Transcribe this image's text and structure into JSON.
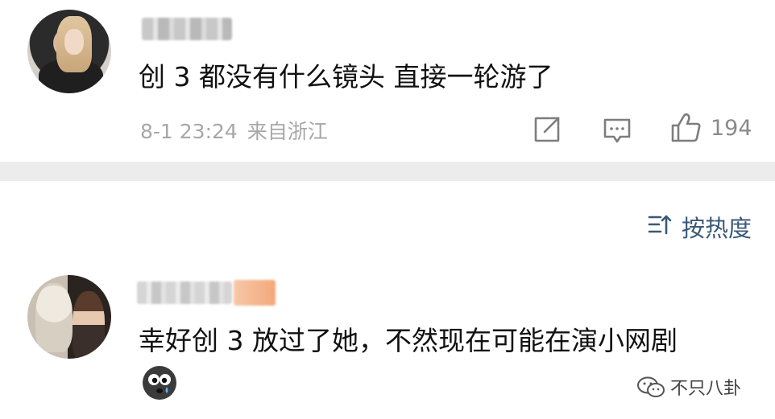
{
  "comments": [
    {
      "text": "创 3 都没有什么镜头 直接一轮游了",
      "meta": {
        "date": "8-1 23:24",
        "location": "来自浙江"
      },
      "like_count": "194"
    },
    {
      "text": "幸好创 3 放过了她，不然现在可能在演小网剧"
    }
  ],
  "sort": {
    "label": "按热度"
  },
  "icons": {
    "share": "share-icon",
    "comment": "comment-bubble-icon",
    "like": "thumbs-up-icon",
    "sort": "sort-icon",
    "emoji": "crying-face-emoji",
    "watermark": "wechat-icon"
  },
  "watermark": {
    "text": "不只八卦"
  },
  "colors": {
    "text": "#111111",
    "meta": "#a7a7a7",
    "divider": "#ececec",
    "sort_label": "#3a5878"
  }
}
